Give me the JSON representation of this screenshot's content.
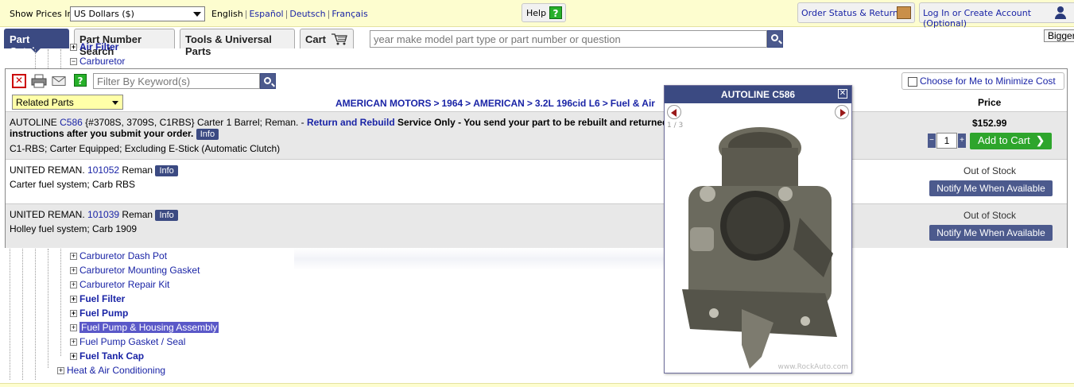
{
  "topbar": {
    "show_prices_label": "Show Prices In",
    "currency": "US Dollars ($)",
    "languages": [
      "English",
      "Español",
      "Deutsch",
      "Français"
    ],
    "help_label": "Help",
    "order_status": "Order Status & Returns",
    "login": "Log In or Create Account (Optional)"
  },
  "tabs": {
    "catalog": "Part Catalog",
    "part_number_search": "Part Number Search",
    "tools": "Tools & Universal Parts",
    "cart": "Cart"
  },
  "search": {
    "placeholder": "year make model part type or part number or question"
  },
  "bigger_label": "Bigger",
  "tree_top": [
    {
      "label": "Air Filter",
      "sign": "+"
    },
    {
      "label": "Carburetor",
      "sign": "−"
    }
  ],
  "tree_bottom": [
    {
      "label": "Carburetor Dash Pot",
      "bold": false,
      "highlight": false
    },
    {
      "label": "Carburetor Mounting Gasket",
      "bold": false,
      "highlight": false
    },
    {
      "label": "Carburetor Repair Kit",
      "bold": false,
      "highlight": false
    },
    {
      "label": "Fuel Filter",
      "bold": true,
      "highlight": false
    },
    {
      "label": "Fuel Pump",
      "bold": true,
      "highlight": false
    },
    {
      "label": "Fuel Pump & Housing Assembly",
      "bold": false,
      "highlight": true
    },
    {
      "label": "Fuel Pump Gasket / Seal",
      "bold": false,
      "highlight": false
    },
    {
      "label": "Fuel Tank Cap",
      "bold": true,
      "highlight": false
    }
  ],
  "tree_heat": "Heat & Air Conditioning",
  "panel": {
    "filter_placeholder": "Filter By Keyword(s)",
    "minimize_label": "Choose for Me to Minimize Cost",
    "related_parts": "Related Parts",
    "breadcrumb": [
      "AMERICAN MOTORS",
      "1964",
      "AMERICAN",
      "3.2L 196cid L6",
      "Fuel & Air"
    ],
    "price_header": "Price",
    "info_label": "Info",
    "rows": [
      {
        "brand": "AUTOLINE",
        "part_no": "C586",
        "alt": "{#3708S, 3709S, C1RBS}",
        "desc": "Carter 1 Barrel; Reman. -",
        "rr_link": "Return and Rebuild",
        "rr_text": "Service Only - You send your part to be rebuilt and returned",
        "rr_text2": "instructions after you submit your order.",
        "notes": "C1-RBS; Carter Equipped; Excluding E-Stick (Automatic Clutch)",
        "price": "$152.99",
        "qty": "1",
        "add_to_cart": "Add to Cart"
      },
      {
        "brand": "UNITED REMAN.",
        "part_no": "101052",
        "desc": "Reman",
        "notes": "Carter fuel system; Carb RBS",
        "stock": "Out of Stock",
        "notify": "Notify Me When Available"
      },
      {
        "brand": "UNITED REMAN.",
        "part_no": "101039",
        "desc": "Reman",
        "notes": "Holley fuel system; Carb 1909",
        "stock": "Out of Stock",
        "notify": "Notify Me When Available"
      }
    ]
  },
  "popup": {
    "title": "AUTOLINE C586",
    "counter": "1 / 3",
    "watermark": "www.RockAuto.com"
  }
}
